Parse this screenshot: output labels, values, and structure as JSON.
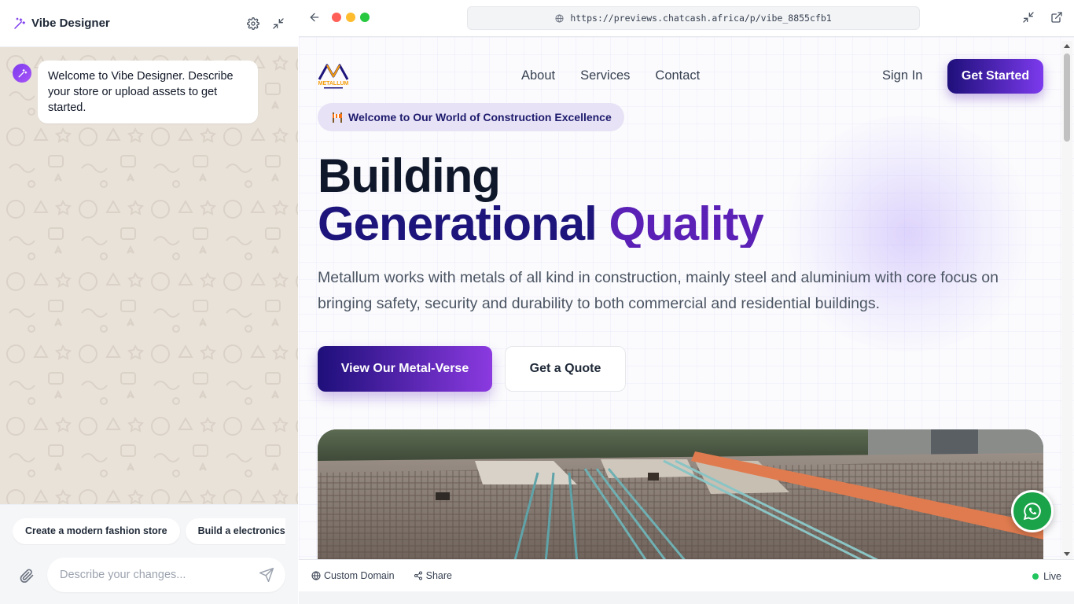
{
  "left_panel": {
    "title": "Vibe Designer",
    "header_icons": [
      "wand-icon",
      "gear-icon",
      "collapse-icon"
    ],
    "chat": {
      "messages": [
        {
          "from": "assistant",
          "text": "Welcome to Vibe Designer. Describe your store or upload assets to get started."
        }
      ]
    },
    "suggestions": [
      "Create a modern fashion store",
      "Build a electronics"
    ],
    "composer": {
      "placeholder": "Describe your changes...",
      "value": ""
    }
  },
  "browser": {
    "url": "https://previews.chatcash.africa/p/vibe_8855cfb1",
    "traffic_colors": [
      "#ff5f57",
      "#febc2e",
      "#28c840"
    ]
  },
  "site": {
    "logo_text": "METALLUM",
    "nav": [
      "About",
      "Services",
      "Contact"
    ],
    "sign_in": "Sign In",
    "get_started": "Get Started",
    "badge": "Welcome to Our World of Construction Excellence",
    "headline_line1": "Building",
    "headline_line2_part1": "Generational",
    "headline_line2_part2": "Quality",
    "subtitle": "Metallum works with metals of all kind in construction, mainly steel and aluminium with core focus on bringing safety, security and durability to both commercial and residential buildings.",
    "cta_primary": "View Our Metal-Verse",
    "cta_secondary": "Get a Quote",
    "colors": {
      "primary_dark": "#1e0f7a",
      "accent": "#7c3aed",
      "whatsapp": "#1ba34a"
    }
  },
  "bottom_bar": {
    "custom_domain": "Custom Domain",
    "share": "Share",
    "status": "Live",
    "status_color": "#22c55e"
  }
}
